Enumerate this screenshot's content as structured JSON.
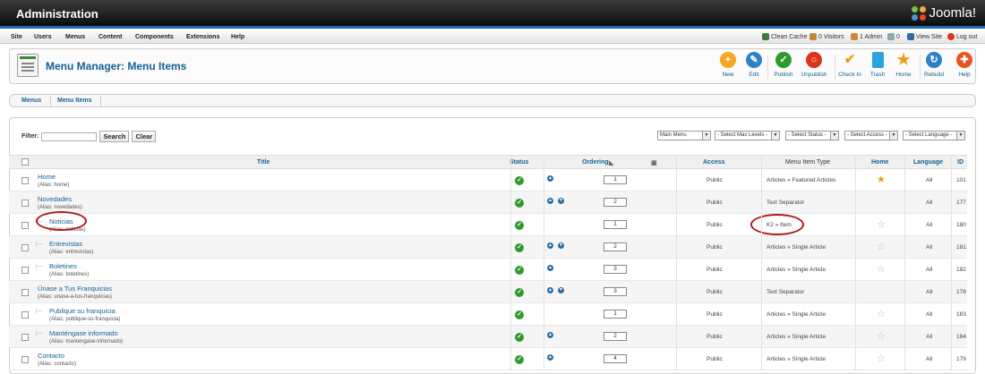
{
  "header": {
    "title": "Administration",
    "logo_text": "Joomla!"
  },
  "topmenu": {
    "items": [
      "Site",
      "Users",
      "Menus",
      "Content",
      "Components",
      "Extensions",
      "Help"
    ],
    "status": [
      "Clean Cache",
      "0 Visitors",
      "1 Admin",
      "0",
      "View Site",
      "Log out"
    ]
  },
  "toolbar": {
    "page_title": "Menu Manager: Menu Items",
    "buttons": [
      {
        "label": "New",
        "icon": "plus-icon",
        "color": "#f5a623"
      },
      {
        "label": "Edit",
        "icon": "pencil-icon",
        "color": "#2d82c6"
      },
      {
        "label": "Publish",
        "icon": "check-icon",
        "color": "#2e9a2e"
      },
      {
        "label": "Unpublish",
        "icon": "circle-x-icon",
        "color": "#d9341c"
      },
      {
        "label": "Check In",
        "icon": "checkmark-icon",
        "color": "#f39c12"
      },
      {
        "label": "Trash",
        "icon": "trash-icon",
        "color": "#2ba3dd"
      },
      {
        "label": "Home",
        "icon": "star-icon",
        "color": "#f39c12"
      },
      {
        "label": "Rebuild",
        "icon": "refresh-icon",
        "color": "#2d82c6"
      },
      {
        "label": "Help",
        "icon": "lifebuoy-icon",
        "color": "#e8541f"
      }
    ]
  },
  "subtabs": [
    "Menus",
    "Menu Items"
  ],
  "filter": {
    "label": "Filter:",
    "value": "",
    "search_label": "Search",
    "clear_label": "Clear",
    "selects": [
      "Main Menu",
      "- Select Max Levels -",
      "- Select Status -",
      "- Select Access -",
      "- Select Language -"
    ]
  },
  "table": {
    "headers": {
      "title": "Title",
      "status": "Status",
      "ordering": "Ordering",
      "access": "Access",
      "type": "Menu Item Type",
      "home": "Home",
      "language": "Language",
      "id": "ID"
    },
    "rows": [
      {
        "title": "Home",
        "alias": "(Alias: home)",
        "arrows": 1,
        "order": "1",
        "access": "Public",
        "type": "Articles » Featured Articles",
        "home": true,
        "lang": "All",
        "id": "101",
        "level": 1
      },
      {
        "title": "Novedades",
        "alias": "(Alias: novedades)",
        "arrows": 2,
        "order": "2",
        "access": "Public",
        "type": "Text Separator",
        "home": null,
        "lang": "All",
        "id": "177",
        "level": 1
      },
      {
        "title": "Noticias",
        "alias": "(Alias: noticias)",
        "arrows": 0,
        "order": "1",
        "access": "Public",
        "type": "K2 » Item",
        "home": false,
        "lang": "All",
        "id": "180",
        "level": 2
      },
      {
        "title": "Entrevistas",
        "alias": "(Alias: entrevistas)",
        "arrows": 2,
        "order": "2",
        "access": "Public",
        "type": "Articles » Single Article",
        "home": false,
        "lang": "All",
        "id": "181",
        "level": 2
      },
      {
        "title": "Boletines",
        "alias": "(Alias: boletines)",
        "arrows": 1,
        "order": "3",
        "access": "Public",
        "type": "Articles » Single Article",
        "home": false,
        "lang": "All",
        "id": "182",
        "level": 2
      },
      {
        "title": "Únase a Tus Franquicias",
        "alias": "(Alias: unase-a-tus-franquicias)",
        "arrows": 2,
        "order": "3",
        "access": "Public",
        "type": "Text Separator",
        "home": null,
        "lang": "All",
        "id": "178",
        "level": 1
      },
      {
        "title": "Publique su franquicia",
        "alias": "(Alias: publique-su-franquicia)",
        "arrows": 0,
        "order": "1",
        "access": "Public",
        "type": "Articles » Single Article",
        "home": false,
        "lang": "All",
        "id": "183",
        "level": 2
      },
      {
        "title": "Manténgase informado",
        "alias": "(Alias: mantengase-informado)",
        "arrows": 1,
        "order": "2",
        "access": "Public",
        "type": "Articles » Single Article",
        "home": false,
        "lang": "All",
        "id": "184",
        "level": 2
      },
      {
        "title": "Contacto",
        "alias": "(Alias: contacto)",
        "arrows": 1,
        "order": "4",
        "access": "Public",
        "type": "Articles » Single Article",
        "home": false,
        "lang": "All",
        "id": "179",
        "level": 1
      }
    ]
  }
}
